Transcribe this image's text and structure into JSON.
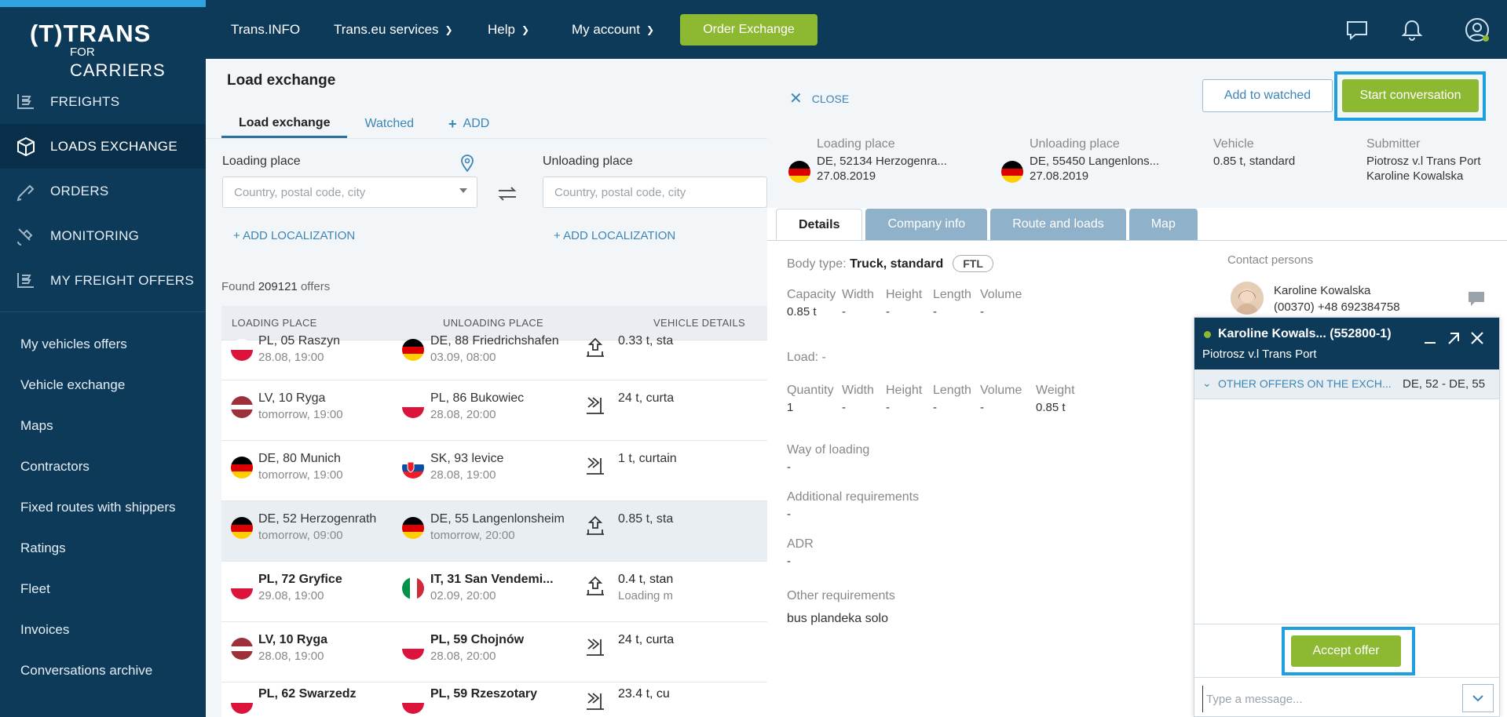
{
  "brand": {
    "logo_top": "(T)TRANS",
    "logo_for": "FOR",
    "logo_carriers": "CARRIERS"
  },
  "sidebar": {
    "main": [
      {
        "label": "FREIGHTS",
        "icon": "freights-icon"
      },
      {
        "label": "LOADS EXCHANGE",
        "icon": "box-icon"
      },
      {
        "label": "ORDERS",
        "icon": "orders-icon"
      },
      {
        "label": "MONITORING",
        "icon": "satellite-icon"
      },
      {
        "label": "MY FREIGHT OFFERS",
        "icon": "freight-offers-icon"
      }
    ],
    "sub": [
      "My vehicles offers",
      "Vehicle exchange",
      "Maps",
      "Contractors",
      "Fixed routes with shippers",
      "Ratings",
      "Fleet",
      "Invoices",
      "Conversations archive"
    ]
  },
  "topbar": {
    "transinfo": "Trans.INFO",
    "services": "Trans.eu services",
    "help": "Help",
    "account": "My account",
    "order_exchange": "Order Exchange"
  },
  "main": {
    "title": "Load exchange",
    "tabs": {
      "load_exchange": "Load exchange",
      "watched": "Watched",
      "add": "ADD"
    },
    "loading_label": "Loading place",
    "unloading_label": "Unloading place",
    "placeholder": "Country, postal code, city",
    "add_localization": "ADD LOCALIZATION",
    "found_prefix": "Found",
    "found_count": "209121",
    "found_suffix": "offers",
    "headers": {
      "loading": "LOADING PLACE",
      "unloading": "UNLOADING PLACE",
      "vehicle": "VEHICLE DETAILS"
    },
    "rows": [
      {
        "from_flag": "pl",
        "from": "PL, 05 Raszyn",
        "from_date": "28.08, 19:00",
        "to_flag": "de",
        "to": "DE, 88 Friedrichshafen",
        "to_date": "03.09, 08:00",
        "vehicle": "0.33 t, sta",
        "vehicle2": "",
        "icon": "load-up-icon"
      },
      {
        "from_flag": "lv",
        "from": "LV, 10 Ryga",
        "from_date": "tomorrow, 19:00",
        "to_flag": "pl",
        "to": "PL, 86 Bukowiec",
        "to_date": "28.08, 20:00",
        "vehicle": "24 t, curta",
        "vehicle2": "",
        "icon": "load-side-icon"
      },
      {
        "from_flag": "de",
        "from": "DE, 80 Munich",
        "from_date": "tomorrow, 19:00",
        "to_flag": "sk",
        "to": "SK, 93 levice",
        "to_date": "28.08, 19:00",
        "vehicle": "1 t, curtain",
        "vehicle2": "",
        "icon": "load-side-icon"
      },
      {
        "from_flag": "de",
        "from": "DE, 52 Herzogenrath",
        "from_date": "tomorrow, 09:00",
        "to_flag": "de",
        "to": "DE, 55 Langenlonsheim",
        "to_date": "tomorrow, 20:00",
        "vehicle": "0.85 t, sta",
        "vehicle2": "",
        "icon": "load-up-icon"
      },
      {
        "from_flag": "pl",
        "from": "PL, 72 Gryfice",
        "from_date": "29.08, 19:00",
        "to_flag": "it",
        "to": "IT, 31 San Vendemi...",
        "to_date": "02.09, 20:00",
        "vehicle": "0.4 t, stan",
        "vehicle2": "Loading m",
        "icon": "load-up-icon"
      },
      {
        "from_flag": "lv",
        "from": "LV, 10 Ryga",
        "from_date": "28.08, 19:00",
        "to_flag": "pl",
        "to": "PL, 59 Chojnów",
        "to_date": "28.08, 20:00",
        "vehicle": "24 t, curta",
        "vehicle2": "",
        "icon": "load-side-icon"
      },
      {
        "from_flag": "pl",
        "from": "PL, 62 Swarzedz",
        "from_date": "",
        "to_flag": "pl",
        "to": "PL, 59 Rzeszotary",
        "to_date": "",
        "vehicle": "23.4 t, cu",
        "vehicle2": "",
        "icon": "load-side-icon"
      }
    ]
  },
  "panel": {
    "close": "CLOSE",
    "add_watched": "Add to watched",
    "start_conversation": "Start conversation",
    "loading_place_label": "Loading place",
    "loading_place": "DE, 52134 Herzogenra...",
    "loading_date": "27.08.2019",
    "unloading_place_label": "Unloading place",
    "unloading_place": "DE, 55450 Langenlons...",
    "unloading_date": "27.08.2019",
    "vehicle_label": "Vehicle",
    "vehicle": "0.85 t, standard",
    "submitter_label": "Submitter",
    "submitter_company": "Piotrosz v.l Trans Port",
    "submitter_name": "Karoline Kowalska",
    "tabs": [
      "Details",
      "Company info",
      "Route and loads",
      "Map"
    ],
    "body_type_label": "Body type:",
    "body_type": "Truck, standard",
    "ftl": "FTL",
    "cap_headers": [
      "Capacity",
      "Width",
      "Height",
      "Length",
      "Volume"
    ],
    "cap_values": [
      "0.85 t",
      "-",
      "-",
      "-",
      "-"
    ],
    "load_label": "Load:",
    "load_value": "-",
    "load_headers": [
      "Quantity",
      "Width",
      "Height",
      "Length",
      "Volume",
      "Weight"
    ],
    "load_values": [
      "1",
      "-",
      "-",
      "-",
      "-",
      "0.85 t"
    ],
    "way_label": "Way of loading",
    "way_value": "-",
    "addreq_label": "Additional requirements",
    "addreq_value": "-",
    "adr_label": "ADR",
    "adr_value": "-",
    "other_label": "Other requirements",
    "other_value": "bus plandeka solo",
    "contact_label": "Contact persons",
    "contact_name": "Karoline Kowalska",
    "contact_phone": "(00370) +48 692384758"
  },
  "chat": {
    "name": "Karoline Kowals... (552800-1)",
    "company": "Piotrosz v.l Trans Port",
    "other_offers": "OTHER OFFERS ON THE EXCH...",
    "route": "DE, 52 - DE, 55",
    "accept": "Accept offer",
    "placeholder": "Type a message..."
  },
  "colors": {
    "navy": "#0e3a5a",
    "green": "#8cb832",
    "blue_link": "#3b85b7",
    "highlight_frame": "#1ea0e0"
  }
}
